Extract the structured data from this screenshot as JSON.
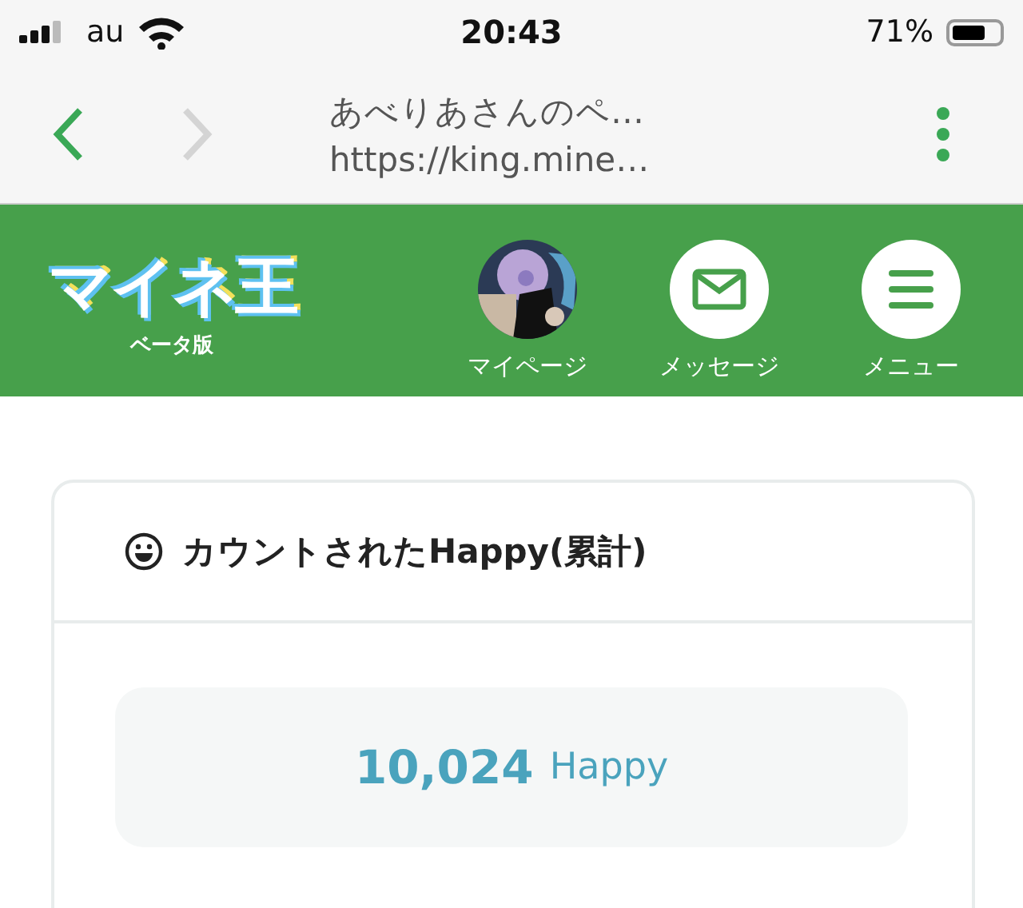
{
  "status_bar": {
    "carrier": "au",
    "time": "20:43",
    "battery_percent": "71%"
  },
  "browser": {
    "page_title": "あべりあさんのペ…",
    "url": "https://king.mine…",
    "back_disabled": false,
    "forward_disabled": true
  },
  "header": {
    "logo": "マイネ王",
    "logo_badge": "ベータ版",
    "nav": [
      {
        "kind": "avatar",
        "label": "マイページ"
      },
      {
        "kind": "mail",
        "label": "メッセージ"
      },
      {
        "kind": "menu",
        "label": "メニュー"
      }
    ]
  },
  "card": {
    "title": "カウントされたHappy(累計)",
    "count": "10,024",
    "unit": "Happy"
  }
}
